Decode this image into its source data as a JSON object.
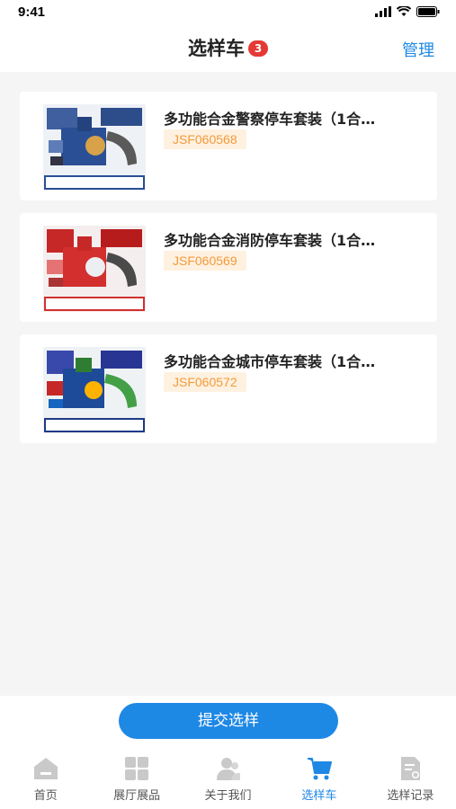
{
  "status": {
    "time": "9:41"
  },
  "nav": {
    "title": "选样车",
    "badge": "3",
    "manage": "管理"
  },
  "items": [
    {
      "title": "多功能合金警察停车套装（1合…",
      "code": "JSF060568",
      "theme": "police"
    },
    {
      "title": "多功能合金消防停车套装（1合…",
      "code": "JSF060569",
      "theme": "fire"
    },
    {
      "title": "多功能合金城市停车套装（1合…",
      "code": "JSF060572",
      "theme": "city"
    }
  ],
  "submit_label": "提交选样",
  "tabs": [
    {
      "label": "首页",
      "icon": "home-icon"
    },
    {
      "label": "展厅展品",
      "icon": "grid-icon"
    },
    {
      "label": "关于我们",
      "icon": "users-icon"
    },
    {
      "label": "选样车",
      "icon": "cart-icon",
      "active": true
    },
    {
      "label": "选样记录",
      "icon": "record-icon"
    }
  ],
  "colors": {
    "accent": "#1e88e5",
    "badge": "#e53935",
    "code_text": "#f39a3a",
    "code_bg": "#fff1e0"
  }
}
